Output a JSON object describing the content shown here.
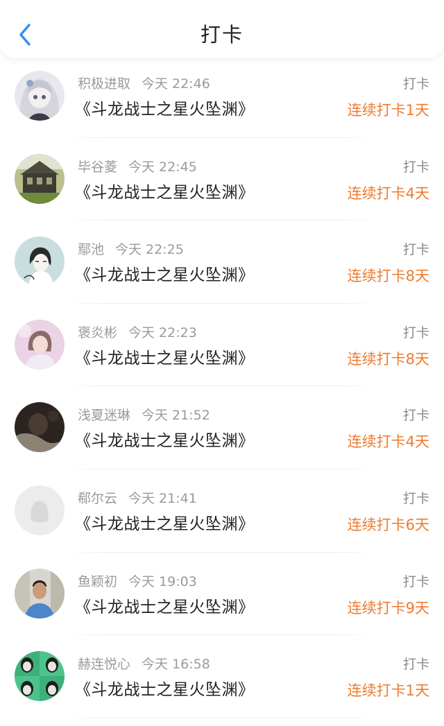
{
  "header": {
    "title": "打卡",
    "back_icon": "chevron-left-icon",
    "accent_color": "#2f8ff0"
  },
  "colors": {
    "streak": "#ee7b2f",
    "meta": "#9a9a9a",
    "text": "#222222"
  },
  "entries": [
    {
      "user": "积极进取",
      "time": "今天 22:46",
      "action": "打卡",
      "book": "《斗龙战士之星火坠渊》",
      "streak": "连续打卡1天",
      "avatar": "anime-girl-avatar"
    },
    {
      "user": "毕谷菱",
      "time": "今天 22:45",
      "action": "打卡",
      "book": "《斗龙战士之星火坠渊》",
      "streak": "连续打卡4天",
      "avatar": "house-photo-avatar"
    },
    {
      "user": "鄢池",
      "time": "今天 22:25",
      "action": "打卡",
      "book": "《斗龙战士之星火坠渊》",
      "streak": "连续打卡8天",
      "avatar": "sketch-girl-avatar"
    },
    {
      "user": "褒炎彬",
      "time": "今天 22:23",
      "action": "打卡",
      "book": "《斗龙战士之星火坠渊》",
      "streak": "连续打卡8天",
      "avatar": "pink-portrait-avatar"
    },
    {
      "user": "浅夏迷琳",
      "time": "今天 21:52",
      "action": "打卡",
      "book": "《斗龙战士之星火坠渊》",
      "streak": "连续打卡4天",
      "avatar": "dark-photo-avatar"
    },
    {
      "user": "郗尔云",
      "time": "今天 21:41",
      "action": "打卡",
      "book": "《斗龙战士之星火坠渊》",
      "streak": "连续打卡6天",
      "avatar": "default-penguin-avatar"
    },
    {
      "user": "鱼颖初",
      "time": "今天 19:03",
      "action": "打卡",
      "book": "《斗龙战士之星火坠渊》",
      "streak": "连续打卡9天",
      "avatar": "boy-photo-avatar"
    },
    {
      "user": "赫连悦心",
      "time": "今天 16:58",
      "action": "打卡",
      "book": "《斗龙战士之星火坠渊》",
      "streak": "连续打卡1天",
      "avatar": "green-faces-avatar"
    }
  ]
}
